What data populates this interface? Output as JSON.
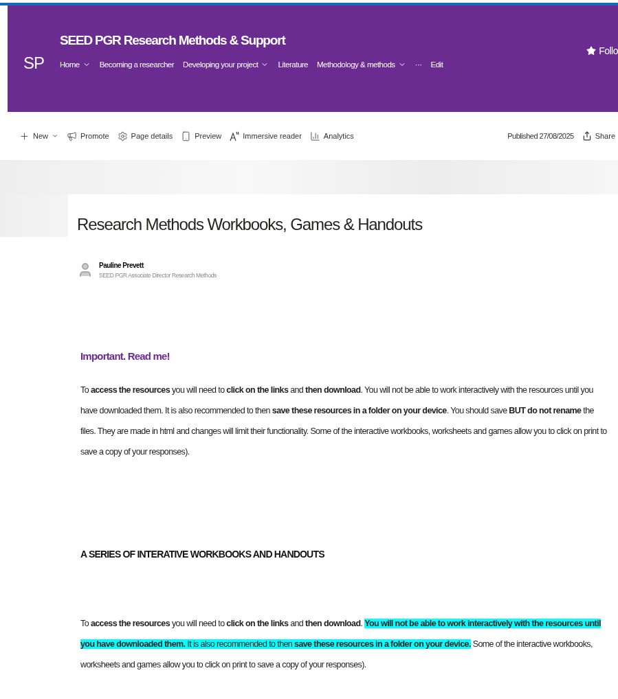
{
  "site": {
    "logo": "SP",
    "title": "SEED PGR Research Methods & Support",
    "follow": "Follo"
  },
  "nav": [
    {
      "label": "Home",
      "dropdown": true
    },
    {
      "label": "Becoming a researcher",
      "dropdown": false
    },
    {
      "label": "Developing your project",
      "dropdown": true
    },
    {
      "label": "Literature",
      "dropdown": false
    },
    {
      "label": "Methodology & methods",
      "dropdown": true
    },
    {
      "label": "···",
      "dropdown": false
    },
    {
      "label": "Edit",
      "dropdown": false
    }
  ],
  "toolbar": [
    {
      "kind": "new",
      "label": "New"
    },
    {
      "kind": "promote",
      "label": "Promote"
    },
    {
      "kind": "details",
      "label": "Page details"
    },
    {
      "kind": "preview",
      "label": "Preview"
    },
    {
      "kind": "reader",
      "label": "Immersive reader"
    },
    {
      "kind": "analytics",
      "label": "Analytics"
    }
  ],
  "published": "Published 27/08/2025",
  "share": "Share",
  "page": {
    "title": "Research Methods Workbooks, Games & Handouts",
    "author": {
      "name": "Pauline Prevett",
      "role": "SEED PGR Associate Director Research Methods"
    },
    "sections": [
      {
        "kind": "subheading",
        "text": "Important. Read me!"
      },
      {
        "kind": "paragraph",
        "segments": [
          {
            "text": "To **access the resources** you will need to **click on the links** and **then download**. You will not be able to work interactively with the resources until you have downloaded them. It is also recommended to then **save these resources in a folder on your device**. You should save **BUT do not rename** the files. They are made in html and changes will limit their functionality. Some of the interactive workbooks, worksheets and games allow you to click on print to save a copy of your responses).",
            "highlighted": false
          }
        ]
      },
      {
        "kind": "heading",
        "text": "A SERIES OF INTERATIVE WORKBOOKS AND HANDOUTS"
      },
      {
        "kind": "paragraph",
        "segments": [
          {
            "text": "To **access the resources** you will need to **click on the links** and **then download**. ",
            "highlighted": false
          },
          {
            "text": "**You will not be able to work interactively with the resources until you have downloaded them.** It is also recommended to then **save these resources in a folder on your device.**",
            "highlighted": true
          },
          {
            "text": " Some of the interactive workbooks, worksheets and games allow you to click on print to save a copy of your responses).",
            "highlighted": false
          }
        ]
      }
    ]
  }
}
